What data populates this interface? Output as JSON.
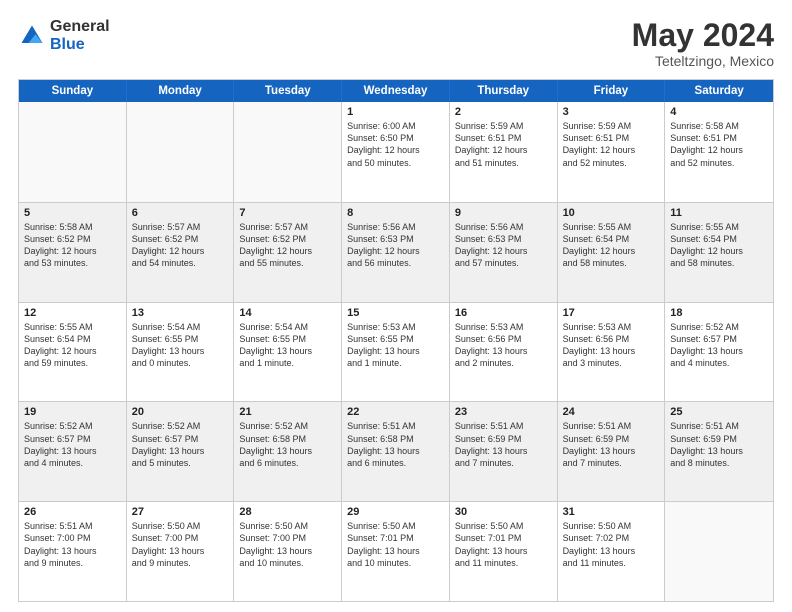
{
  "logo": {
    "general": "General",
    "blue": "Blue"
  },
  "header": {
    "month_year": "May 2024",
    "location": "Teteltzingo, Mexico"
  },
  "weekdays": [
    "Sunday",
    "Monday",
    "Tuesday",
    "Wednesday",
    "Thursday",
    "Friday",
    "Saturday"
  ],
  "rows": [
    [
      {
        "day": "",
        "info": ""
      },
      {
        "day": "",
        "info": ""
      },
      {
        "day": "",
        "info": ""
      },
      {
        "day": "1",
        "info": "Sunrise: 6:00 AM\nSunset: 6:50 PM\nDaylight: 12 hours\nand 50 minutes."
      },
      {
        "day": "2",
        "info": "Sunrise: 5:59 AM\nSunset: 6:51 PM\nDaylight: 12 hours\nand 51 minutes."
      },
      {
        "day": "3",
        "info": "Sunrise: 5:59 AM\nSunset: 6:51 PM\nDaylight: 12 hours\nand 52 minutes."
      },
      {
        "day": "4",
        "info": "Sunrise: 5:58 AM\nSunset: 6:51 PM\nDaylight: 12 hours\nand 52 minutes."
      }
    ],
    [
      {
        "day": "5",
        "info": "Sunrise: 5:58 AM\nSunset: 6:52 PM\nDaylight: 12 hours\nand 53 minutes."
      },
      {
        "day": "6",
        "info": "Sunrise: 5:57 AM\nSunset: 6:52 PM\nDaylight: 12 hours\nand 54 minutes."
      },
      {
        "day": "7",
        "info": "Sunrise: 5:57 AM\nSunset: 6:52 PM\nDaylight: 12 hours\nand 55 minutes."
      },
      {
        "day": "8",
        "info": "Sunrise: 5:56 AM\nSunset: 6:53 PM\nDaylight: 12 hours\nand 56 minutes."
      },
      {
        "day": "9",
        "info": "Sunrise: 5:56 AM\nSunset: 6:53 PM\nDaylight: 12 hours\nand 57 minutes."
      },
      {
        "day": "10",
        "info": "Sunrise: 5:55 AM\nSunset: 6:54 PM\nDaylight: 12 hours\nand 58 minutes."
      },
      {
        "day": "11",
        "info": "Sunrise: 5:55 AM\nSunset: 6:54 PM\nDaylight: 12 hours\nand 58 minutes."
      }
    ],
    [
      {
        "day": "12",
        "info": "Sunrise: 5:55 AM\nSunset: 6:54 PM\nDaylight: 12 hours\nand 59 minutes."
      },
      {
        "day": "13",
        "info": "Sunrise: 5:54 AM\nSunset: 6:55 PM\nDaylight: 13 hours\nand 0 minutes."
      },
      {
        "day": "14",
        "info": "Sunrise: 5:54 AM\nSunset: 6:55 PM\nDaylight: 13 hours\nand 1 minute."
      },
      {
        "day": "15",
        "info": "Sunrise: 5:53 AM\nSunset: 6:55 PM\nDaylight: 13 hours\nand 1 minute."
      },
      {
        "day": "16",
        "info": "Sunrise: 5:53 AM\nSunset: 6:56 PM\nDaylight: 13 hours\nand 2 minutes."
      },
      {
        "day": "17",
        "info": "Sunrise: 5:53 AM\nSunset: 6:56 PM\nDaylight: 13 hours\nand 3 minutes."
      },
      {
        "day": "18",
        "info": "Sunrise: 5:52 AM\nSunset: 6:57 PM\nDaylight: 13 hours\nand 4 minutes."
      }
    ],
    [
      {
        "day": "19",
        "info": "Sunrise: 5:52 AM\nSunset: 6:57 PM\nDaylight: 13 hours\nand 4 minutes."
      },
      {
        "day": "20",
        "info": "Sunrise: 5:52 AM\nSunset: 6:57 PM\nDaylight: 13 hours\nand 5 minutes."
      },
      {
        "day": "21",
        "info": "Sunrise: 5:52 AM\nSunset: 6:58 PM\nDaylight: 13 hours\nand 6 minutes."
      },
      {
        "day": "22",
        "info": "Sunrise: 5:51 AM\nSunset: 6:58 PM\nDaylight: 13 hours\nand 6 minutes."
      },
      {
        "day": "23",
        "info": "Sunrise: 5:51 AM\nSunset: 6:59 PM\nDaylight: 13 hours\nand 7 minutes."
      },
      {
        "day": "24",
        "info": "Sunrise: 5:51 AM\nSunset: 6:59 PM\nDaylight: 13 hours\nand 7 minutes."
      },
      {
        "day": "25",
        "info": "Sunrise: 5:51 AM\nSunset: 6:59 PM\nDaylight: 13 hours\nand 8 minutes."
      }
    ],
    [
      {
        "day": "26",
        "info": "Sunrise: 5:51 AM\nSunset: 7:00 PM\nDaylight: 13 hours\nand 9 minutes."
      },
      {
        "day": "27",
        "info": "Sunrise: 5:50 AM\nSunset: 7:00 PM\nDaylight: 13 hours\nand 9 minutes."
      },
      {
        "day": "28",
        "info": "Sunrise: 5:50 AM\nSunset: 7:00 PM\nDaylight: 13 hours\nand 10 minutes."
      },
      {
        "day": "29",
        "info": "Sunrise: 5:50 AM\nSunset: 7:01 PM\nDaylight: 13 hours\nand 10 minutes."
      },
      {
        "day": "30",
        "info": "Sunrise: 5:50 AM\nSunset: 7:01 PM\nDaylight: 13 hours\nand 11 minutes."
      },
      {
        "day": "31",
        "info": "Sunrise: 5:50 AM\nSunset: 7:02 PM\nDaylight: 13 hours\nand 11 minutes."
      },
      {
        "day": "",
        "info": ""
      }
    ]
  ]
}
